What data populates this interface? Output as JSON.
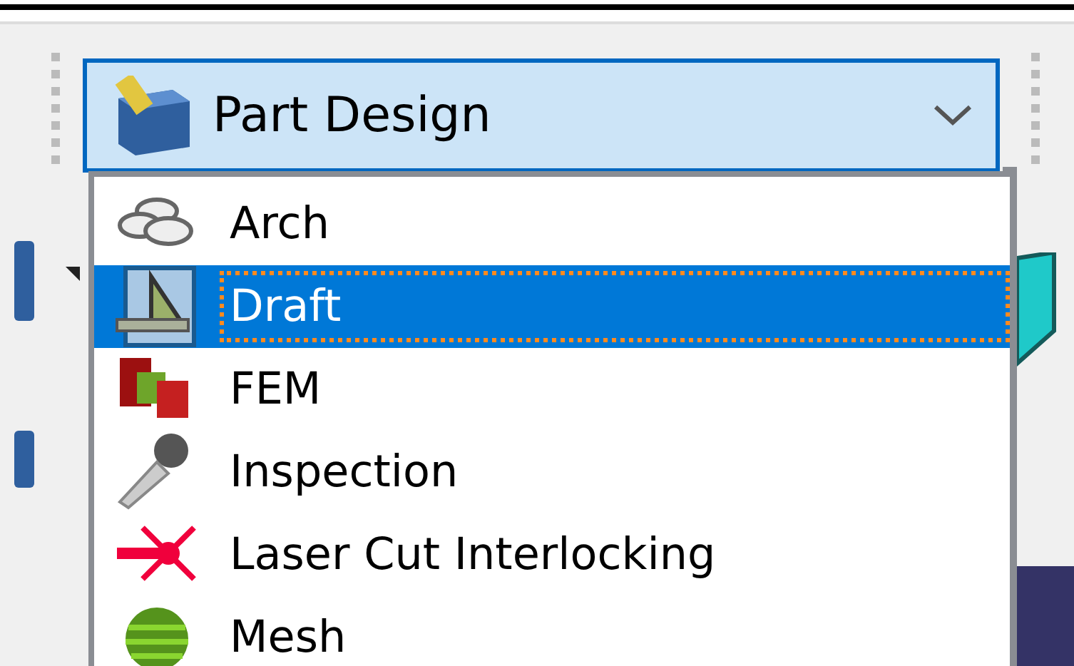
{
  "workbench_selector": {
    "value": "Part Design",
    "expanded": true
  },
  "workbench_list": [
    {
      "label": "Arch",
      "selected": false
    },
    {
      "label": "Draft",
      "selected": true
    },
    {
      "label": "FEM",
      "selected": false
    },
    {
      "label": "Inspection",
      "selected": false
    },
    {
      "label": "Laser Cut Interlocking",
      "selected": false
    },
    {
      "label": "Mesh",
      "selected": false
    }
  ]
}
